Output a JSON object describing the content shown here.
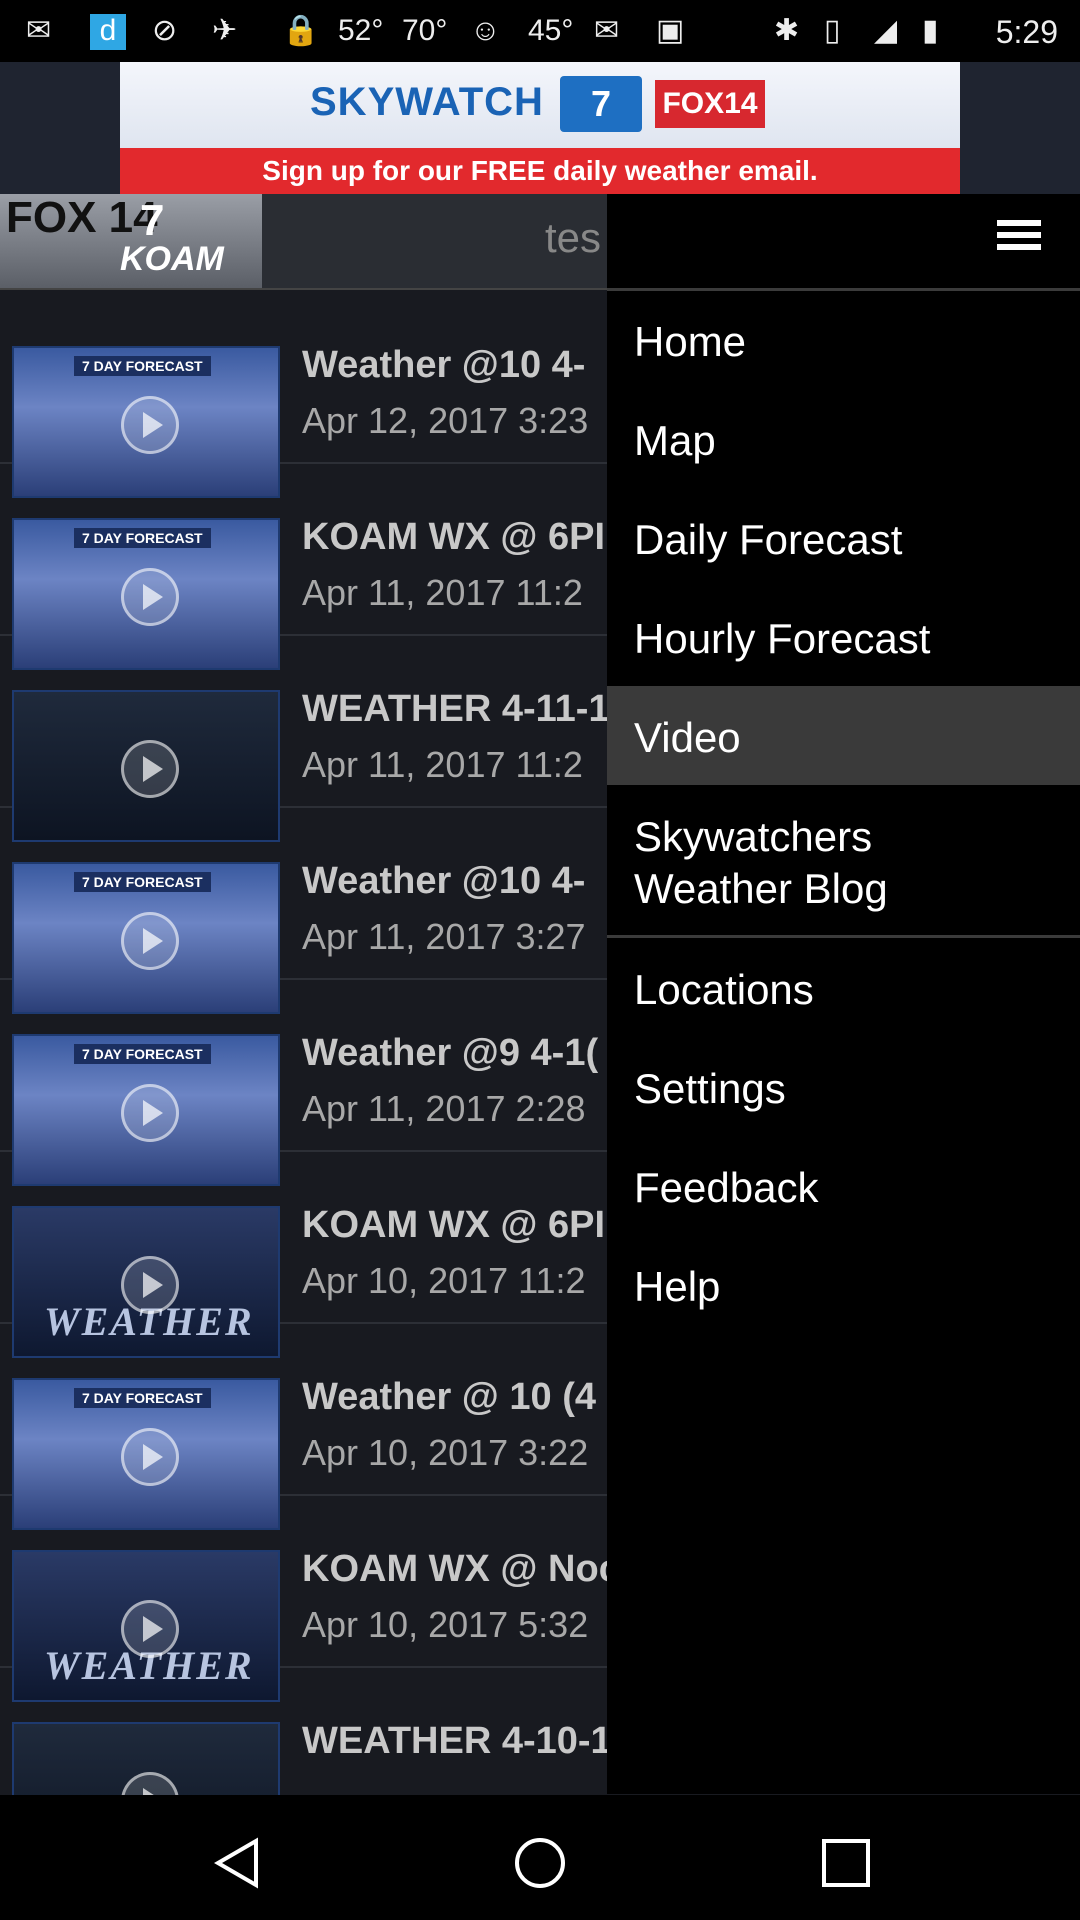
{
  "status_bar": {
    "temps": [
      "52°",
      "70°",
      "45°"
    ],
    "time": "5:29"
  },
  "ad": {
    "brand_primary": "SKYWATCH",
    "brand_secondary": "7",
    "brand_tertiary": "FOX14",
    "cta": "Sign up for our FREE daily weather email."
  },
  "header": {
    "brand_fox": "FOX 14",
    "brand_koam": "KOAM",
    "brand_seven": "7",
    "title": "tes"
  },
  "videos": [
    {
      "title": "Weather @10 4-",
      "date": "Apr 12, 2017 3:23",
      "thumb": "forecast",
      "label": "7 DAY FORECAST"
    },
    {
      "title": "KOAM WX @ 6PI",
      "date": "Apr 11, 2017 11:2",
      "thumb": "forecast",
      "label": "7 DAY FORECAST"
    },
    {
      "title": "WEATHER 4-11-1",
      "date": "Apr 11, 2017 11:2",
      "thumb": "studio",
      "label": ""
    },
    {
      "title": "Weather @10 4-",
      "date": "Apr 11, 2017 3:27",
      "thumb": "forecast",
      "label": "7 DAY FORECAST"
    },
    {
      "title": "Weather @9 4-1(",
      "date": "Apr 11, 2017 2:28",
      "thumb": "forecast",
      "label": "7 DAY FORECAST"
    },
    {
      "title": "KOAM WX @ 6PI",
      "date": "Apr 10, 2017 11:2",
      "thumb": "weather",
      "label": "WEATHER"
    },
    {
      "title": "Weather @ 10 (4",
      "date": "Apr 10, 2017 3:22",
      "thumb": "forecast",
      "label": "7 DAY FORECAST"
    },
    {
      "title": "KOAM WX @ Noc",
      "date": "Apr 10, 2017 5:32",
      "thumb": "weather",
      "label": "WEATHER"
    },
    {
      "title": "WEATHER 4-10-1",
      "date": "",
      "thumb": "studio",
      "label": ""
    }
  ],
  "menu": {
    "items": [
      {
        "label": "Home"
      },
      {
        "label": "Map"
      },
      {
        "label": "Daily Forecast"
      },
      {
        "label": "Hourly Forecast"
      },
      {
        "label": "Video"
      },
      {
        "label": "Skywatchers\nWeather Blog"
      },
      {
        "label": "Locations"
      },
      {
        "label": "Settings"
      },
      {
        "label": "Feedback"
      },
      {
        "label": "Help"
      }
    ],
    "active": "Video"
  }
}
